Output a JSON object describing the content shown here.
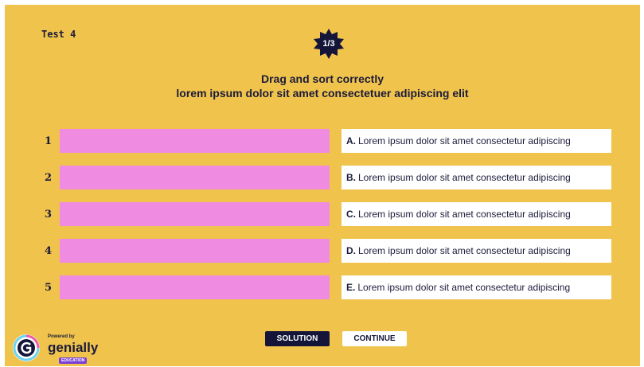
{
  "header": {
    "test_label": "Test 4",
    "progress": "1/3",
    "title_line1": "Drag and sort correctly",
    "title_line2": "lorem ipsum dolor sit amet consectetuer adipiscing elit"
  },
  "slots": [
    {
      "number": "1"
    },
    {
      "number": "2"
    },
    {
      "number": "3"
    },
    {
      "number": "4"
    },
    {
      "number": "5"
    }
  ],
  "options": [
    {
      "letter": "A.",
      "text": "Lorem ipsum dolor sit amet consectetur adipiscing"
    },
    {
      "letter": "B.",
      "text": "Lorem ipsum dolor sit amet consectetur adipiscing"
    },
    {
      "letter": "C.",
      "text": "Lorem ipsum dolor sit amet consectetur adipiscing"
    },
    {
      "letter": "D.",
      "text": "Lorem ipsum dolor sit amet consectetur adipiscing"
    },
    {
      "letter": "E.",
      "text": "Lorem ipsum dolor sit amet consectetur adipiscing"
    }
  ],
  "buttons": {
    "solution": "SOLUTION",
    "continue": "CONTINUE"
  },
  "branding": {
    "powered_by": "Powered by",
    "wordmark": "genially",
    "edu_badge": "EDUCATION"
  },
  "colors": {
    "background": "#f0c34c",
    "drop_slot": "#f08be2",
    "navy": "#141538",
    "white": "#ffffff"
  }
}
